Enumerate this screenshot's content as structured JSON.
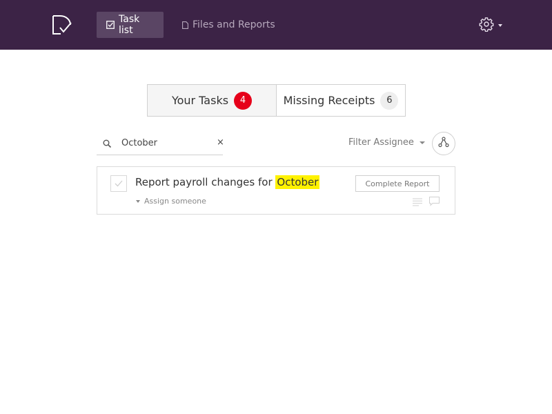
{
  "nav": {
    "tabs": [
      {
        "label": "Task list",
        "icon": "checkbox-icon",
        "active": true
      },
      {
        "label": "Files and Reports",
        "icon": "document-icon",
        "active": false
      }
    ],
    "settings_icon": "gear-icon"
  },
  "segments": {
    "your_tasks": {
      "label": "Your Tasks",
      "count": "4"
    },
    "missing_receipts": {
      "label": "Missing Receipts",
      "count": "6"
    }
  },
  "search": {
    "value": "October",
    "clear_label": "×"
  },
  "filter": {
    "label": "Filter Assignee"
  },
  "tasks": [
    {
      "title_prefix": "Report payroll changes for",
      "title_highlight": "October",
      "assign_label": "Assign someone",
      "action_label": "Complete Report"
    }
  ],
  "colors": {
    "topbar": "#3c2346",
    "active_tab": "#5a4564",
    "badge_red": "#e6001a",
    "highlight": "#fff200"
  }
}
